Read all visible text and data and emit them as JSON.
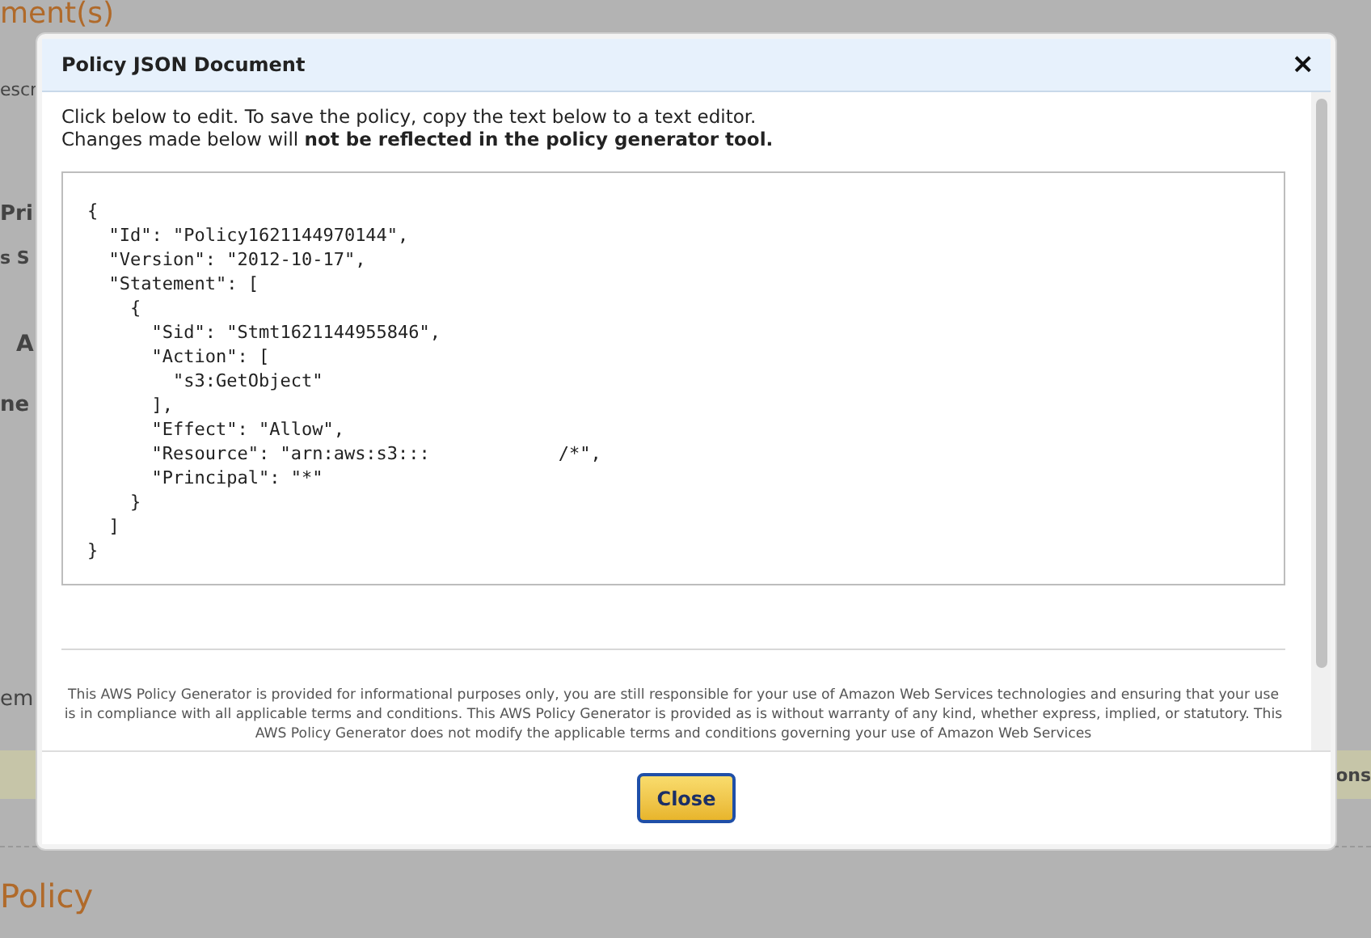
{
  "background_page": {
    "heading": "ment(s)",
    "fragments": [
      "escr",
      "Pri",
      "s S",
      "A",
      "ne",
      "em",
      "ons"
    ],
    "section_heading": "Policy"
  },
  "dialog": {
    "title": "Policy JSON Document",
    "close_glyph": "×",
    "intro": [
      "Click below to edit. To save the policy, copy the text below to a text editor.",
      "Changes made below will **not be reflected in the policy generator tool.**"
    ],
    "policy_lines": [
      "{",
      "  \"Id\": \"Policy1621144970144\",",
      "  \"Version\": \"2012-10-17\",",
      "  \"Statement\": [",
      "    {",
      "      \"Sid\": \"Stmt1621144955846\",",
      "      \"Action\": [",
      "        \"s3:GetObject\"",
      "      ],",
      "      \"Effect\": \"Allow\",",
      "      \"Resource\": \"arn:aws:s3:::            /*\",",
      "      \"Principal\": \"*\"",
      "    }",
      "  ]",
      "}"
    ],
    "disclaimer": "This AWS Policy Generator is provided for informational purposes only, you are still responsible for your use of Amazon Web Services technologies and ensuring that your use is in compliance with all applicable terms and conditions. This AWS Policy Generator is provided as is without warranty of any kind, whether express, implied, or statutory. This AWS Policy Generator does not modify the applicable terms and conditions governing your use of Amazon Web Services",
    "buttons": [
      "Close"
    ]
  }
}
